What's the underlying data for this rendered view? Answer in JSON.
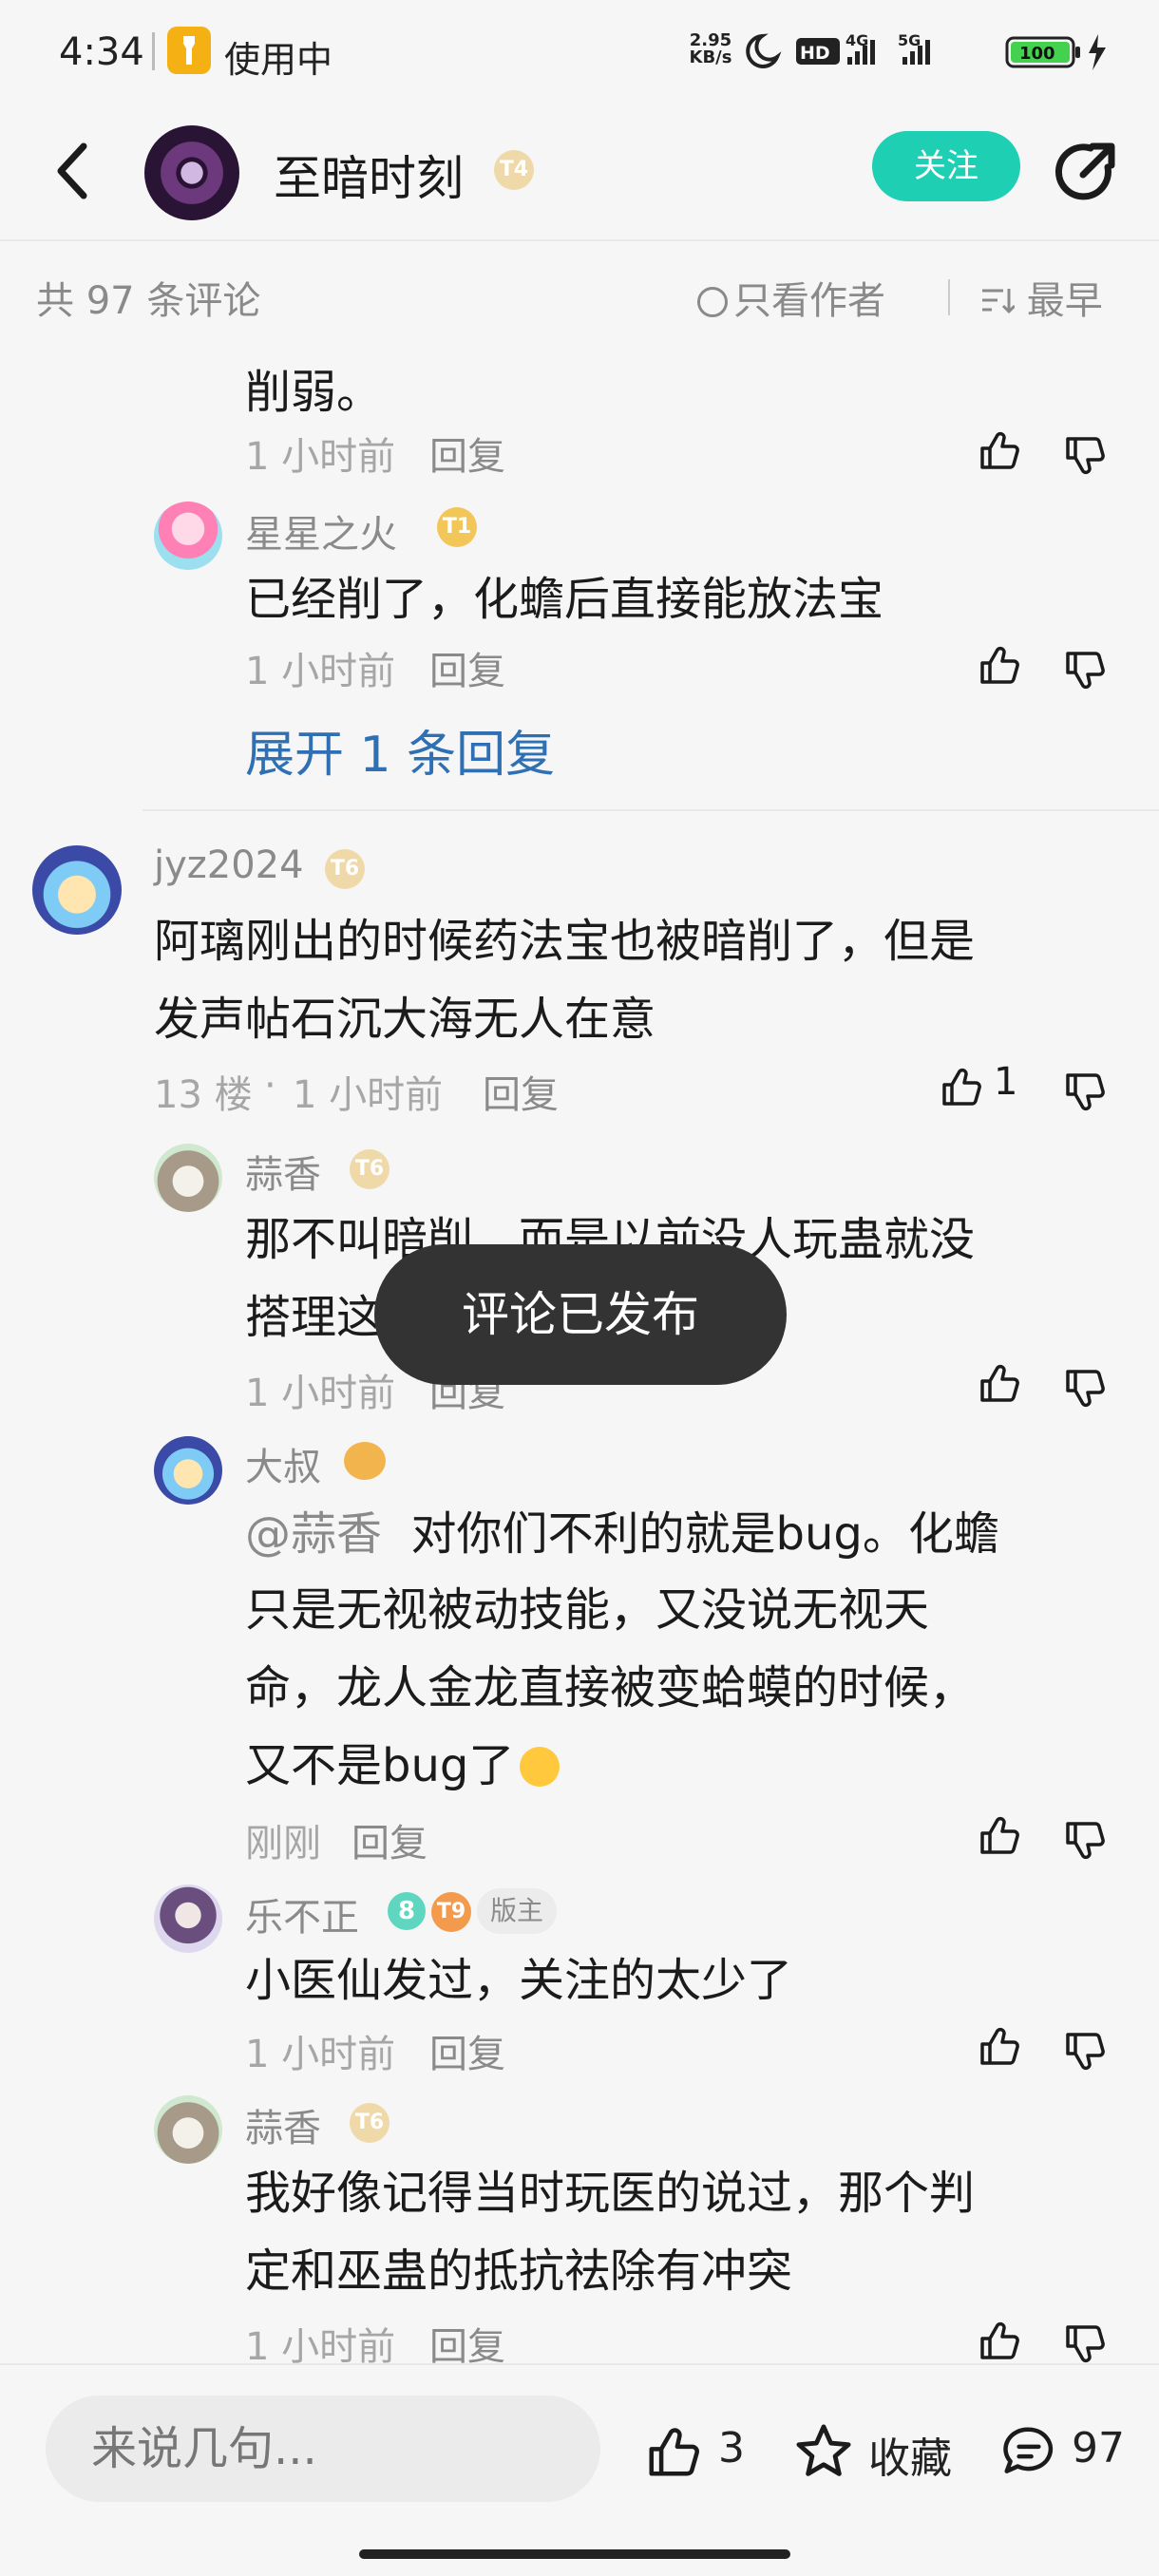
{
  "status_bar": {
    "time": "4:34",
    "in_use": "使用中",
    "net_speed_value": "2.95",
    "net_speed_unit": "KB/s",
    "battery": "100",
    "hd_label": "HD",
    "net_4g": "4G",
    "net_5g": "5G"
  },
  "header": {
    "forum_name": "至暗时刻",
    "forum_level": "T4",
    "follow_label": "关注"
  },
  "sub_header": {
    "total_comments": "共 97 条评论",
    "only_author": "只看作者",
    "sort_label": "最早"
  },
  "thread1": {
    "tail_text": "削弱。",
    "tail_time": "1 小时前",
    "tail_reply": "回复",
    "reply1": {
      "user": "星星之火",
      "level": "T1",
      "text": "已经削了，化蟾后直接能放法宝",
      "time": "1 小时前",
      "reply": "回复"
    },
    "expand": "展开 1 条回复"
  },
  "floor13": {
    "user": "jyz2024",
    "level": "T6",
    "line1": "阿璃刚出的时候药法宝也被暗削了，但是",
    "line2": "发声帖石沉大海无人在意",
    "floor": "13 楼",
    "dot": "·",
    "time": "1 小时前",
    "reply": "回复",
    "likes": "1",
    "replies": [
      {
        "user": "蒜香",
        "level": "T6",
        "line1": "那不叫暗削，而是以前没人玩蛊就没",
        "line2": "搭理这",
        "time": "1 小时前",
        "reply": "回复"
      },
      {
        "user": "大叔",
        "mention": "@蒜香",
        "line1": "对你们不利的就是bug。化蟾",
        "line2": "只是无视被动技能，又没说无视天",
        "line3": "命，龙人金龙直接被变蛤蟆的时候，",
        "line4": "又不是bug了",
        "time": "刚刚",
        "reply": "回复"
      },
      {
        "user": "乐不正",
        "level": "T9",
        "vip": "8",
        "role": "版主",
        "text": "小医仙发过，关注的太少了",
        "time": "1 小时前",
        "reply": "回复"
      },
      {
        "user": "蒜香",
        "level": "T6",
        "line1": "我好像记得当时玩医的说过，那个判",
        "line2": "定和巫蛊的抵抗祛除有冲突",
        "time": "1 小时前",
        "reply": "回复"
      }
    ]
  },
  "toast": "评论已发布",
  "bottom_bar": {
    "input_placeholder": "来说几句...",
    "likes": "3",
    "favorite": "收藏",
    "comments": "97"
  },
  "colors": {
    "accent": "#1fcfb4",
    "link": "#2f6fb3",
    "meta": "#a6a6a6",
    "toast_bg": "#333333"
  },
  "icons": [
    "back-icon",
    "share-icon",
    "thumb-up-icon",
    "thumb-down-icon",
    "star-icon",
    "comment-icon",
    "sort-icon",
    "flashlight-icon",
    "moon-icon",
    "signal-icon",
    "battery-icon",
    "charging-icon"
  ]
}
